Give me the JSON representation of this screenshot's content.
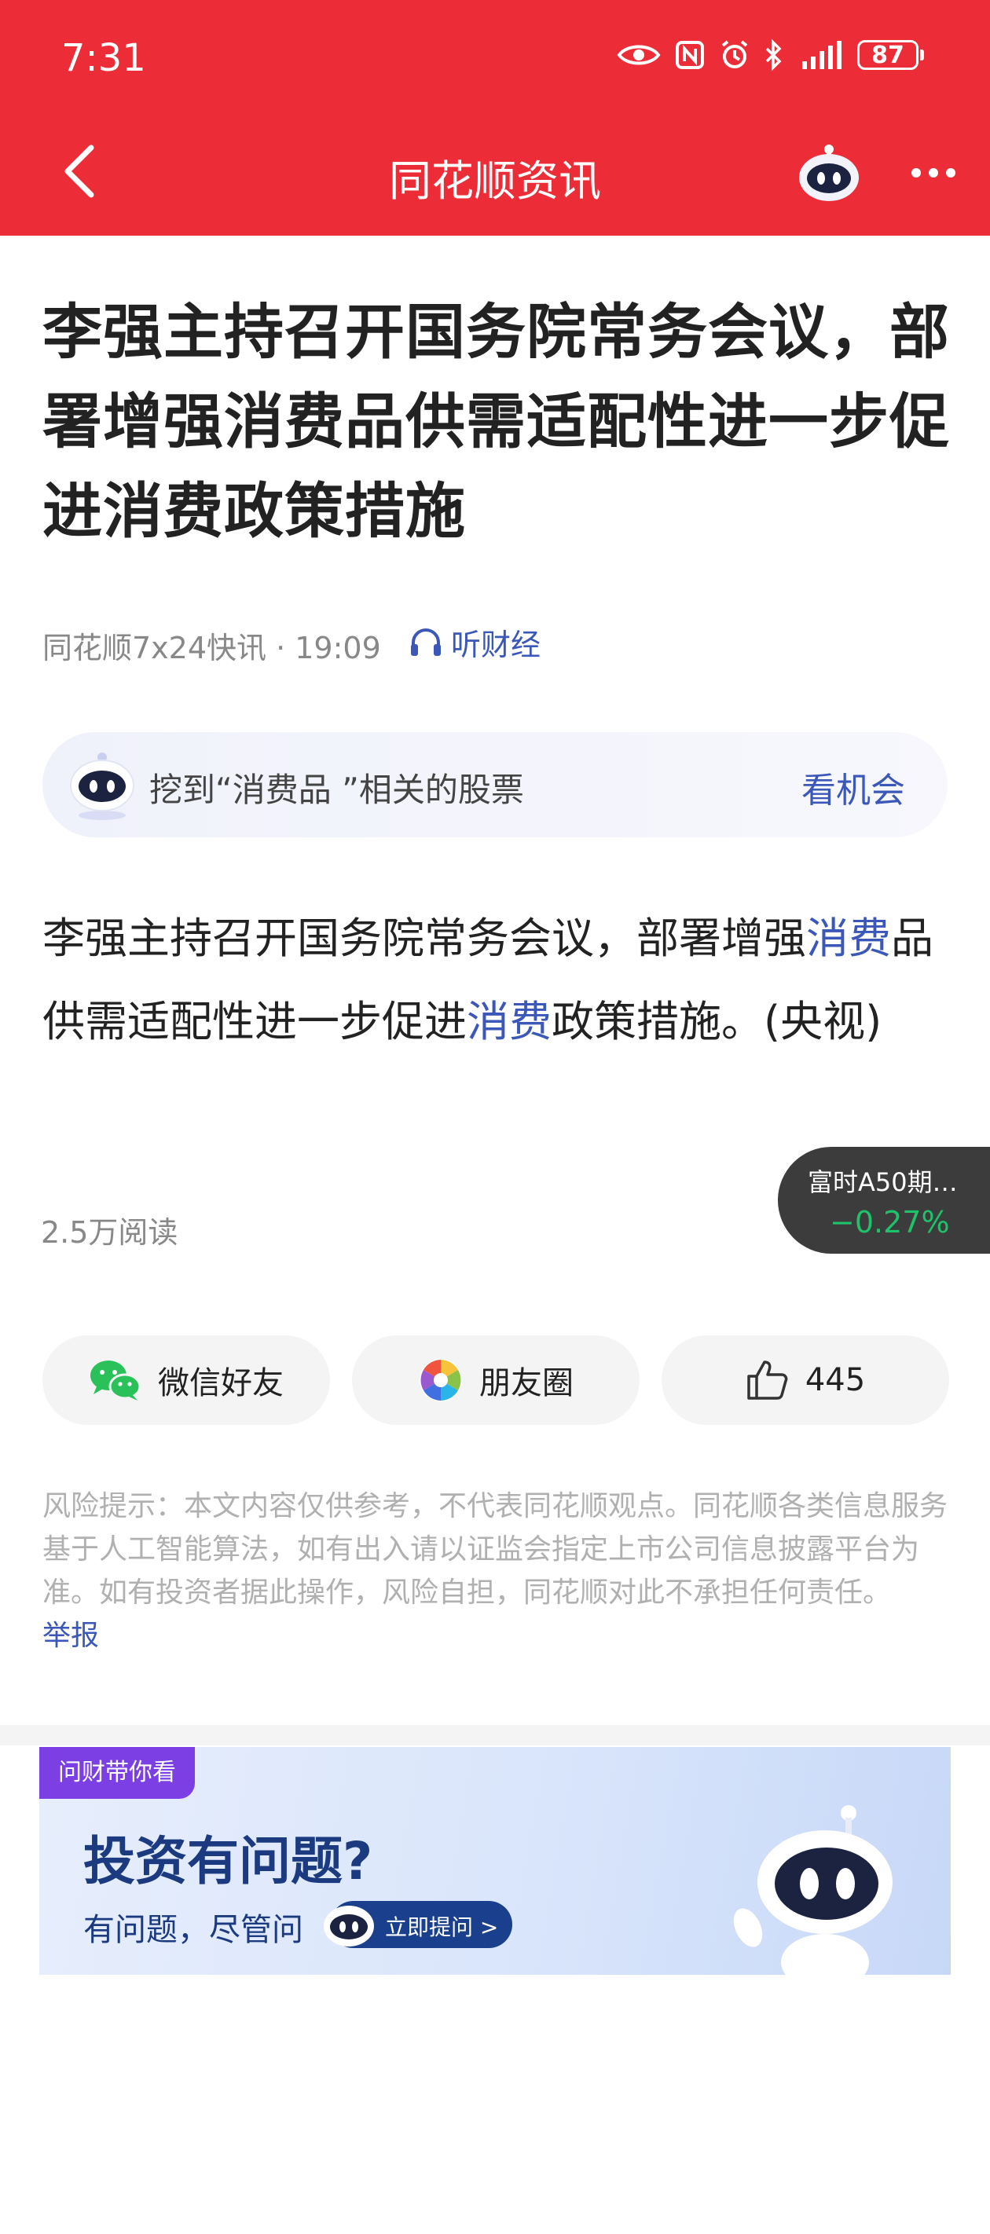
{
  "status_bar": {
    "time": "7:31",
    "battery": "87"
  },
  "nav": {
    "title": "同花顺资讯"
  },
  "article": {
    "title": "李强主持召开国务院常务会议，部署增强消费品供需适配性进一步促进消费政策措施",
    "source_time": "同花顺7x24快讯 · 19:09",
    "listen_label": "听财经",
    "body_1": "李强主持召开国务院常务会议，部署增强",
    "body_hl_1": "消费",
    "body_2": "品供需适配性进一步促进",
    "body_hl_2": "消费",
    "body_3": "政策措施。(央视)",
    "reads": "2.5万阅读"
  },
  "stock_banner": {
    "text": "挖到“消费品 ”相关的股票",
    "cta": "看机会"
  },
  "floating_quote": {
    "name": "富时A50期…",
    "change": "−0.27%"
  },
  "share": {
    "wechat_label": "微信好友",
    "moments_label": "朋友圈",
    "like_count": "445"
  },
  "risk": {
    "text": "风险提示：本文内容仅供参考，不代表同花顺观点。同花顺各类信息服务基于人工智能算法，如有出入请以证监会指定上市公司信息披露平台为准。如有投资者据此操作，风险自担，同花顺对此不承担任何责任。",
    "report_label": "举报"
  },
  "ad": {
    "tag": "问财带你看",
    "title": "投资有问题?",
    "subtitle": "有问题，尽管问",
    "button": "立即提问 >"
  },
  "colors": {
    "header_red": "#ec2c37",
    "link_blue": "#3b57b8",
    "up_green": "#1ec26a"
  }
}
